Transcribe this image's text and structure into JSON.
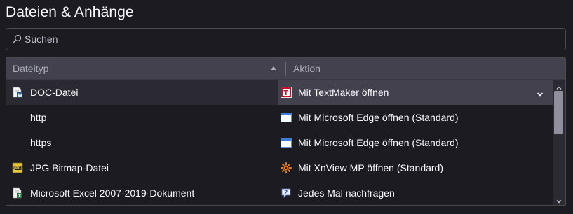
{
  "title": "Dateien & Anhänge",
  "search": {
    "placeholder": "Suchen",
    "value": ""
  },
  "table": {
    "columns": {
      "type": "Dateityp",
      "action": "Aktion"
    },
    "rows": [
      {
        "type": "DOC-Datei",
        "type_icon": "word-doc-icon",
        "action": "Mit TextMaker öffnen",
        "action_icon": "textmaker-icon",
        "selected": true
      },
      {
        "type": "http",
        "type_icon": "",
        "action": "Mit Microsoft Edge öffnen (Standard)",
        "action_icon": "window-app-icon"
      },
      {
        "type": "https",
        "type_icon": "",
        "action": "Mit Microsoft Edge öffnen (Standard)",
        "action_icon": "window-app-icon"
      },
      {
        "type": "JPG Bitmap-Datei",
        "type_icon": "jpg-file-icon",
        "action": "Mit XnView MP öffnen (Standard)",
        "action_icon": "xnview-icon"
      },
      {
        "type": "Microsoft Excel 2007-2019-Dokument",
        "type_icon": "excel-doc-icon",
        "action": "Jedes Mal nachfragen",
        "action_icon": "question-icon"
      }
    ]
  },
  "colors": {
    "background": "#1c1b22",
    "header": "#42414d",
    "selected_action": "#42414d",
    "selected_type": "#2b2a33"
  }
}
